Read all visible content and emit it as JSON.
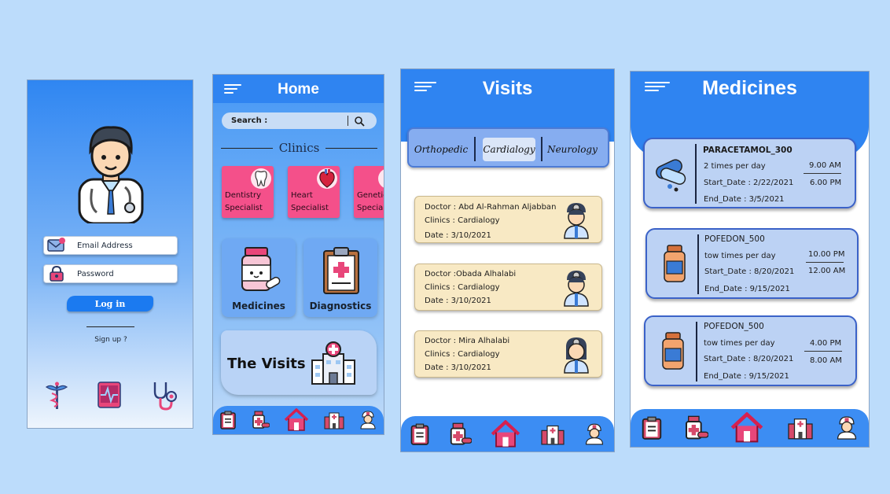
{
  "login": {
    "email_placeholder": "Email Address",
    "password_placeholder": "Password",
    "login_label": "Log in",
    "signup_label": "Sign up ?"
  },
  "home": {
    "title": "Home",
    "search_label": "Search :",
    "clinics_heading": "Clinics",
    "clinics": [
      {
        "label": "Dentistry Specialist"
      },
      {
        "label": "Heart Specialist"
      },
      {
        "label": "Genetic Specialist"
      }
    ],
    "features": [
      {
        "label": "Medicines"
      },
      {
        "label": "Diagnostics"
      }
    ],
    "visits_label": "The Visits"
  },
  "visits": {
    "title": "Visits",
    "tabs": [
      "Orthopedic",
      "Cardialogy",
      "Neurology"
    ],
    "active_tab": "Cardialogy",
    "cards": [
      {
        "doctor": "Doctor : Abd Al-Rahman Aljabban",
        "clinic": "Clinics : Cardialogy",
        "date": "Date : 3/10/2021"
      },
      {
        "doctor": "Doctor :Obada Alhalabi",
        "clinic": "Clinics : Cardialogy",
        "date": "Date : 3/10/2021"
      },
      {
        "doctor": "Doctor : Mira Alhalabi",
        "clinic": "Clinics : Cardialogy",
        "date": "Date : 3/10/2021"
      }
    ]
  },
  "medicines": {
    "title": "Medicines",
    "items": [
      {
        "name": "PARACETAMOL_300",
        "freq": "2  times per day",
        "start": "Start_Date : 2/22/2021",
        "end": "End_Date : 3/5/2021",
        "time1": "9.00 AM",
        "time2": "6.00 PM"
      },
      {
        "name": "POFEDON_500",
        "freq": "tow times per day",
        "start": "Start_Date : 8/20/2021",
        "end": "End_Date : 9/15/2021",
        "time1": "10.00 PM",
        "time2": "12.00 AM"
      },
      {
        "name": "POFEDON_500",
        "freq": "tow times per day",
        "start": "Start_Date : 8/20/2021",
        "end": "End_Date : 9/15/2021",
        "time1": "4.00 PM",
        "time2": "8.00 AM"
      }
    ]
  },
  "colors": {
    "primary": "#2f84f1",
    "clinic_card": "#f4508a",
    "visit_card": "#f8e9c4",
    "med_card": "#bcd2f4"
  },
  "icons": {
    "bottom_nav": [
      "clipboard-icon",
      "medicine-bottle-icon",
      "home-icon",
      "hospital-icon",
      "nurse-icon"
    ]
  }
}
